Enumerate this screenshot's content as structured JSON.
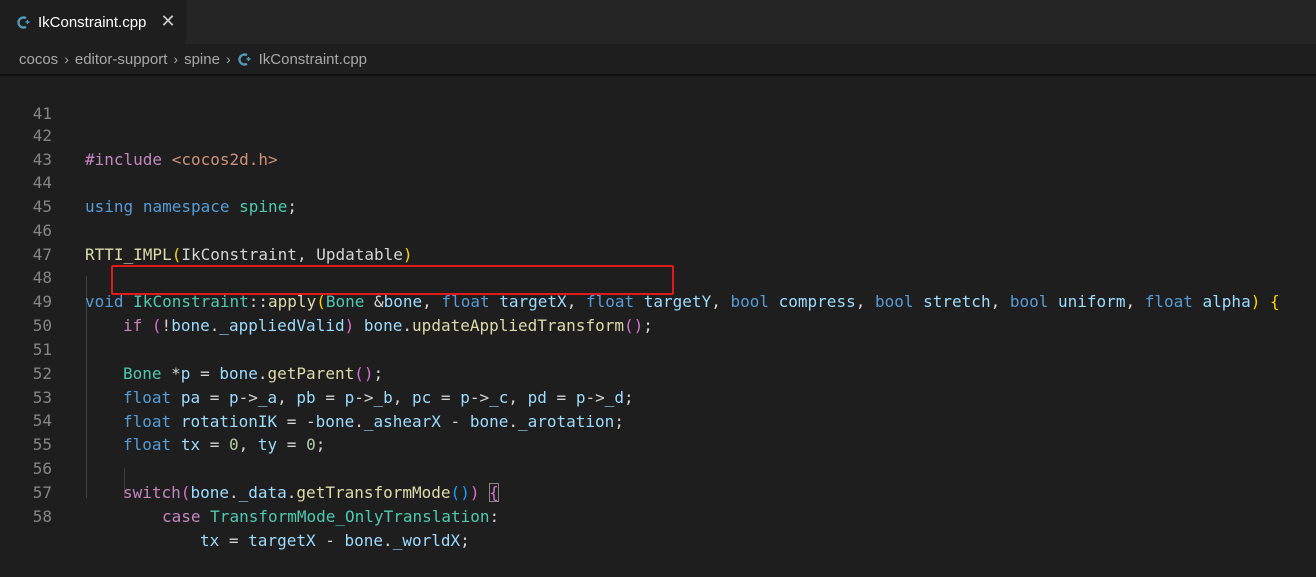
{
  "tab": {
    "filename": "IkConstraint.cpp",
    "close_glyph": "✕",
    "icon": "cpp-file-icon"
  },
  "breadcrumb": {
    "items": [
      "cocos",
      "editor-support",
      "spine",
      "IkConstraint.cpp"
    ],
    "separator": "›"
  },
  "editor": {
    "lines": [
      {
        "num": "41"
      },
      {
        "num": "42"
      },
      {
        "num": "43"
      },
      {
        "num": "44"
      },
      {
        "num": "45"
      },
      {
        "num": "46"
      },
      {
        "num": "47"
      },
      {
        "num": "48"
      },
      {
        "num": "49"
      },
      {
        "num": "50"
      },
      {
        "num": "51"
      },
      {
        "num": "52"
      },
      {
        "num": "53"
      },
      {
        "num": "54"
      },
      {
        "num": "55"
      },
      {
        "num": "56"
      },
      {
        "num": "57"
      },
      {
        "num": "58"
      }
    ],
    "tokens": {
      "l42": [
        "#include",
        " ",
        "<cocos2d.h>"
      ],
      "l44": [
        "using",
        " ",
        "namespace",
        " ",
        "spine",
        ";"
      ],
      "l46": [
        "RTTI_IMPL",
        "(",
        "IkConstraint, Updatable",
        ")"
      ],
      "l48": [
        "void",
        " ",
        "IkConstraint",
        "::",
        "apply",
        "(",
        "Bone",
        " &",
        "bone",
        ", ",
        "float",
        " ",
        "targetX",
        ", ",
        "float",
        " ",
        "targetY",
        ", ",
        "bool",
        " ",
        "compress",
        ", ",
        "bool",
        " ",
        "stretch",
        ", ",
        "bool",
        " ",
        "uniform",
        ", ",
        "float",
        " ",
        "alpha",
        ")",
        " ",
        "{"
      ],
      "l49": [
        "if",
        " ",
        "(",
        "!",
        "bone",
        ".",
        "_appliedValid",
        ")",
        " ",
        "bone",
        ".",
        "updateAppliedTransform",
        "(",
        ")",
        ";"
      ],
      "l51": [
        "Bone",
        " *",
        "p",
        " = ",
        "bone",
        ".",
        "getParent",
        "(",
        ")",
        ";"
      ],
      "l52": [
        "float",
        " ",
        "pa",
        " = ",
        "p",
        "->",
        "_a",
        ", ",
        "pb",
        " = ",
        "p",
        "->",
        "_b",
        ", ",
        "pc",
        " = ",
        "p",
        "->",
        "_c",
        ", ",
        "pd",
        " = ",
        "p",
        "->",
        "_d",
        ";"
      ],
      "l53": [
        "float",
        " ",
        "rotationIK",
        " = -",
        "bone",
        ".",
        "_ashearX",
        " - ",
        "bone",
        ".",
        "_arotation",
        ";"
      ],
      "l54": [
        "float",
        " ",
        "tx",
        " = ",
        "0",
        ", ",
        "ty",
        " = ",
        "0",
        ";"
      ],
      "l56": [
        "switch",
        "(",
        "bone",
        ".",
        "_data",
        ".",
        "getTransformMode",
        "(",
        ")",
        ")",
        " ",
        "{"
      ],
      "l57": [
        "case",
        " ",
        "TransformMode_OnlyTranslation",
        ":"
      ],
      "l58": [
        "tx",
        " = ",
        "targetX",
        " - ",
        "bone",
        ".",
        "_worldX",
        ";"
      ]
    }
  },
  "highlight": {
    "color": "#e0191b",
    "line": "49"
  },
  "colors": {
    "background": "#1e1e1e",
    "keyword": "#569cd6",
    "control": "#c586c0",
    "string": "#ce9178",
    "function": "#dcdcaa",
    "type": "#4ec9b0",
    "variable": "#9cdcfe",
    "number": "#b5cea8"
  }
}
